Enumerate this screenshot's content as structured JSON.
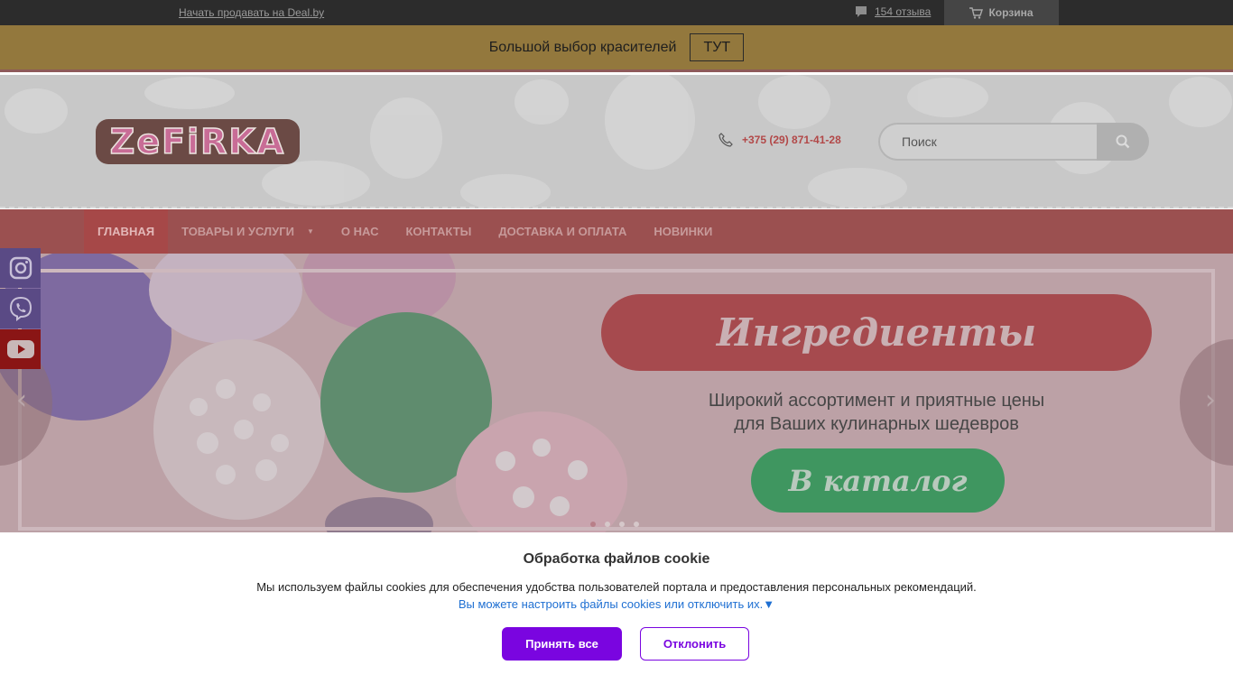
{
  "topbar": {
    "sell_link": "Начать продавать на Deal.by",
    "reviews": "154 отзыва",
    "cart": "Корзина"
  },
  "promo": {
    "text": "Большой выбор красителей",
    "button": "ТУТ"
  },
  "header": {
    "logo_text": "ZeFiRKA",
    "phone": "+375 (29) 871-41-28",
    "search_placeholder": "Поиск"
  },
  "nav": {
    "items": [
      {
        "label": "Главная"
      },
      {
        "label": "Товары и услуги"
      },
      {
        "label": "О нас"
      },
      {
        "label": "Контакты"
      },
      {
        "label": "Доставка и оплата"
      },
      {
        "label": "Новинки"
      }
    ]
  },
  "hero": {
    "title": "Ингредиенты",
    "subtitle_line1": "Широкий ассортимент и приятные цены",
    "subtitle_line2": "для Ваших кулинарных шедевров",
    "cta": "В каталог",
    "slides": 4,
    "active_slide": 1
  },
  "social": {
    "icons": [
      "instagram-icon",
      "viber-icon",
      "youtube-icon"
    ]
  },
  "cookie": {
    "title": "Обработка файлов cookie",
    "text": "Мы используем файлы cookies для обеспечения удобства пользователей портала и предоставления персональных рекомендаций.",
    "settings_link": "Вы можете настроить файлы cookies или отключить их.▼",
    "accept": "Принять все",
    "decline": "Отклонить"
  },
  "colors": {
    "accent_purple": "#7a05e0",
    "nav_red": "#9b5050",
    "promo_gold": "#93783d"
  }
}
